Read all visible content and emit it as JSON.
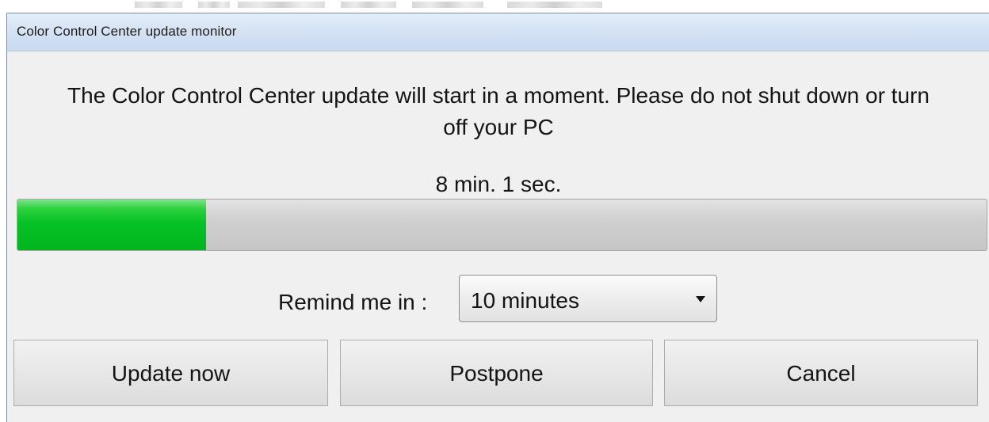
{
  "window": {
    "title": "Color Control Center update monitor"
  },
  "message": {
    "line1": "The Color Control Center update will start in a moment. Please do not shut down or turn",
    "line2": "off your PC"
  },
  "countdown": "8 min. 1 sec.",
  "progress": {
    "fraction": 0.195,
    "color": "#06c227"
  },
  "remind": {
    "label": "Remind me in :",
    "selected": "10 minutes"
  },
  "buttons": {
    "update_now": "Update now",
    "postpone": "Postpone",
    "cancel": "Cancel"
  }
}
